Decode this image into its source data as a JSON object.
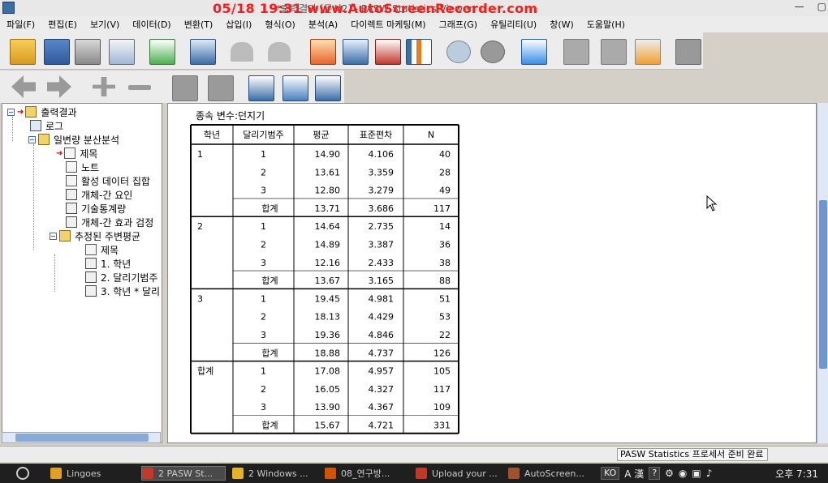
{
  "window": {
    "title": "*출력결과 [문서2] - PASW Statistics Viewer",
    "recorder_overlay": "05/18 19:31 www.AutoScreenRecorder.com"
  },
  "menu": [
    "파일(F)",
    "편집(E)",
    "보기(V)",
    "데이터(D)",
    "변환(T)",
    "삽입(I)",
    "형식(O)",
    "분석(A)",
    "다이렉트 마케팅(M)",
    "그래프(G)",
    "유틸리티(U)",
    "창(W)",
    "도움말(H)"
  ],
  "outline": {
    "items": [
      {
        "label": "출력결과"
      },
      {
        "label": "로그"
      },
      {
        "label": "일변량 분산분석"
      },
      {
        "label": "제목"
      },
      {
        "label": "노트"
      },
      {
        "label": "활성 데이터 집합"
      },
      {
        "label": "개체-간 요인"
      },
      {
        "label": "기술통계량"
      },
      {
        "label": "개체-간 효과 검정"
      },
      {
        "label": "추정된 주변평균"
      },
      {
        "label": "제목"
      },
      {
        "label": "1. 학년"
      },
      {
        "label": "2. 달리기범주"
      },
      {
        "label": "3. 학년 * 달리"
      }
    ]
  },
  "table": {
    "dep_var_label": "종속 변수:던지기",
    "headers": [
      "학년",
      "달리기범주",
      "평균",
      "표준편차",
      "N"
    ],
    "groups": [
      {
        "grade": "1",
        "rows": [
          [
            "1",
            "14.90",
            "4.106",
            "40"
          ],
          [
            "2",
            "13.61",
            "3.359",
            "28"
          ],
          [
            "3",
            "12.80",
            "3.279",
            "49"
          ],
          [
            "합계",
            "13.71",
            "3.686",
            "117"
          ]
        ]
      },
      {
        "grade": "2",
        "rows": [
          [
            "1",
            "14.64",
            "2.735",
            "14"
          ],
          [
            "2",
            "14.89",
            "3.387",
            "36"
          ],
          [
            "3",
            "12.16",
            "2.433",
            "38"
          ],
          [
            "합계",
            "13.67",
            "3.165",
            "88"
          ]
        ]
      },
      {
        "grade": "3",
        "rows": [
          [
            "1",
            "19.45",
            "4.981",
            "51"
          ],
          [
            "2",
            "18.13",
            "4.429",
            "53"
          ],
          [
            "3",
            "19.36",
            "4.846",
            "22"
          ],
          [
            "합계",
            "18.88",
            "4.737",
            "126"
          ]
        ]
      },
      {
        "grade": "합계",
        "rows": [
          [
            "1",
            "17.08",
            "4.957",
            "105"
          ],
          [
            "2",
            "16.05",
            "4.327",
            "117"
          ],
          [
            "3",
            "13.90",
            "4.367",
            "109"
          ],
          [
            "합계",
            "15.67",
            "4.721",
            "331"
          ]
        ]
      }
    ]
  },
  "status": {
    "text": "PASW Statistics 프로세서 준비 완료"
  },
  "taskbar": {
    "items": [
      {
        "label": "Lingoes",
        "color": "#e0a020"
      },
      {
        "label": "2 PASW St...",
        "color": "#c0392b"
      },
      {
        "label": "2 Windows ...",
        "color": "#e6b422"
      },
      {
        "label": "08_연구방...",
        "color": "#d35400"
      },
      {
        "label": "Upload your ...",
        "color": "#c0392b"
      },
      {
        "label": "AutoScreen...",
        "color": "#a0522d"
      }
    ],
    "lang": "KO",
    "ime": "A 漢",
    "clock": "오후 7:31"
  }
}
